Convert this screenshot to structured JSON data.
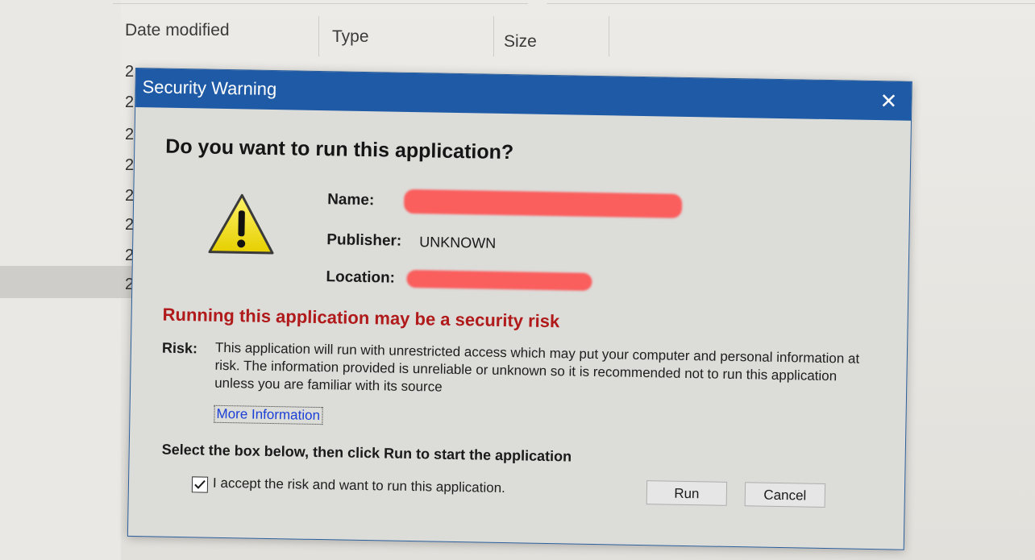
{
  "explorer": {
    "columns": [
      "Date modified",
      "Type",
      "Size"
    ],
    "row_digit": "2"
  },
  "dialog": {
    "title": "Security Warning",
    "close_glyph": "✕",
    "heading": "Do you want to run this application?",
    "fields": {
      "name_label": "Name:",
      "publisher_label": "Publisher:",
      "publisher_value": "UNKNOWN",
      "location_label": "Location:"
    },
    "risk_heading": "Running this application may be a security risk",
    "risk_label": "Risk:",
    "risk_text": "This application will run with unrestricted access which may put your computer and personal information at risk. The information provided is unreliable or unknown so it is recommended not to run this application unless you are familiar with its source",
    "more_info_link": "More Information",
    "select_instruction": "Select the box below, then click Run to start the application",
    "accept_checkbox": {
      "label": "I accept the risk and want to run this application.",
      "checked": true
    },
    "buttons": {
      "run": "Run",
      "cancel": "Cancel"
    }
  },
  "colors": {
    "title_bar": "#1e5aa6",
    "dialog_body": "#dcdcd9",
    "risk_heading": "#b01a1a",
    "link": "#1a3fd6",
    "redaction": "#ff4848",
    "warning_icon_fill": "#f2e300"
  },
  "icons": [
    "warning-triangle-icon",
    "close-icon",
    "checkmark-icon"
  ]
}
